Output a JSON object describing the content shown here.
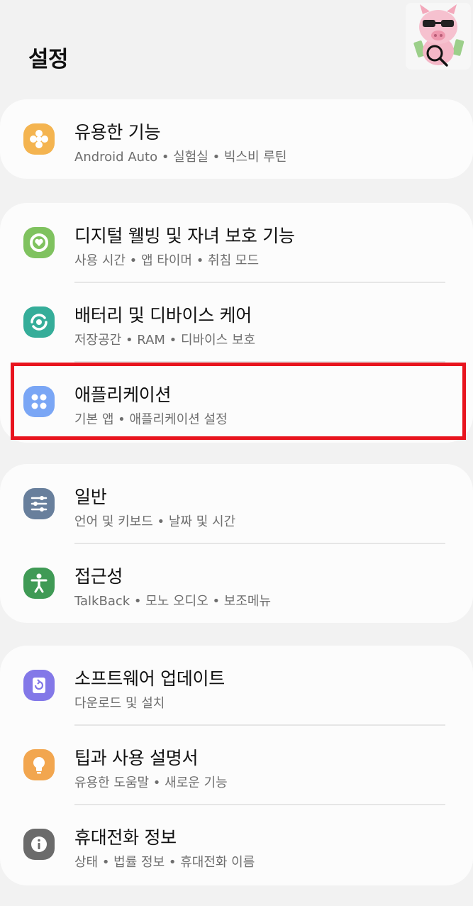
{
  "header": {
    "title": "설정"
  },
  "groups": [
    {
      "items": [
        {
          "title": "유용한 기능",
          "subtitle": "Android Auto  •  실험실  •  빅스비 루틴",
          "icon": "puzzle-flower-icon",
          "color": "#f4b450"
        }
      ]
    },
    {
      "items": [
        {
          "title": "디지털 웰빙 및 자녀 보호 기능",
          "subtitle": "사용 시간  •  앱 타이머  •  취침 모드",
          "icon": "wellbeing-heart-icon",
          "color": "#7fc25f"
        },
        {
          "title": "배터리 및 디바이스 케어",
          "subtitle": "저장공간  •  RAM  •  디바이스 보호",
          "icon": "device-care-icon",
          "color": "#35ad99"
        },
        {
          "title": "애플리케이션",
          "subtitle": "기본 앱  •  애플리케이션 설정",
          "icon": "apps-grid-icon",
          "color": "#7aa6f5"
        }
      ]
    },
    {
      "items": [
        {
          "title": "일반",
          "subtitle": "언어 및 키보드  •  날짜 및 시간",
          "icon": "sliders-icon",
          "color": "#687f9c"
        },
        {
          "title": "접근성",
          "subtitle": "TalkBack  •  모노 오디오  •  보조메뉴",
          "icon": "accessibility-person-icon",
          "color": "#3f9a55"
        }
      ]
    },
    {
      "items": [
        {
          "title": "소프트웨어 업데이트",
          "subtitle": "다운로드 및 설치",
          "icon": "software-update-icon",
          "color": "#8378e8"
        },
        {
          "title": "팁과 사용 설명서",
          "subtitle": "유용한 도움말  •  새로운 기능",
          "icon": "lightbulb-icon",
          "color": "#f2a64f"
        },
        {
          "title": "휴대전화 정보",
          "subtitle": "상태  •  법률 정보  •  휴대전화 이름",
          "icon": "info-icon",
          "color": "#6b6b6b"
        }
      ]
    }
  ],
  "highlight": {
    "color": "#e8141e"
  }
}
